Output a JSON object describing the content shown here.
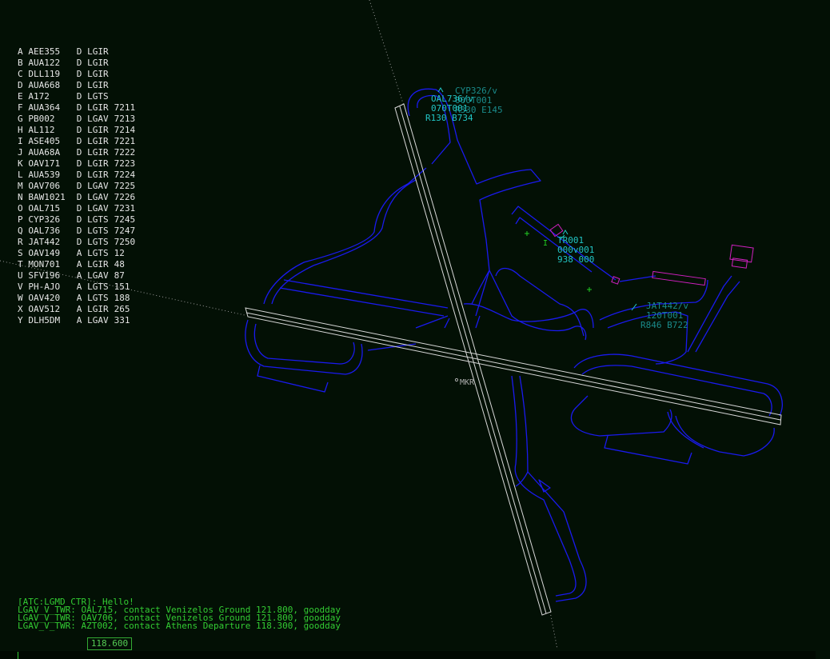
{
  "strip": [
    {
      "letter": "A",
      "callsign": "AEE355",
      "type": "D",
      "airport": "LGIR",
      "code": ""
    },
    {
      "letter": "B",
      "callsign": "AUA122",
      "type": "D",
      "airport": "LGIR",
      "code": ""
    },
    {
      "letter": "C",
      "callsign": "DLL119",
      "type": "D",
      "airport": "LGIR",
      "code": ""
    },
    {
      "letter": "D",
      "callsign": "AUA668",
      "type": "D",
      "airport": "LGIR",
      "code": ""
    },
    {
      "letter": "E",
      "callsign": "A172",
      "type": "D",
      "airport": "LGTS",
      "code": ""
    },
    {
      "letter": "F",
      "callsign": "AUA364",
      "type": "D",
      "airport": "LGIR",
      "code": "7211"
    },
    {
      "letter": "G",
      "callsign": "PB002",
      "type": "D",
      "airport": "LGAV",
      "code": "7213"
    },
    {
      "letter": "H",
      "callsign": "AL112",
      "type": "D",
      "airport": "LGIR",
      "code": "7214"
    },
    {
      "letter": "I",
      "callsign": "ASE405",
      "type": "D",
      "airport": "LGIR",
      "code": "7221"
    },
    {
      "letter": "J",
      "callsign": "AUA68A",
      "type": "D",
      "airport": "LGIR",
      "code": "7222"
    },
    {
      "letter": "K",
      "callsign": "OAV171",
      "type": "D",
      "airport": "LGIR",
      "code": "7223"
    },
    {
      "letter": "L",
      "callsign": "AUA539",
      "type": "D",
      "airport": "LGIR",
      "code": "7224"
    },
    {
      "letter": "M",
      "callsign": "OAV706",
      "type": "D",
      "airport": "LGAV",
      "code": "7225"
    },
    {
      "letter": "N",
      "callsign": "BAW1021",
      "type": "D",
      "airport": "LGAV",
      "code": "7226"
    },
    {
      "letter": "O",
      "callsign": "OAL715",
      "type": "D",
      "airport": "LGAV",
      "code": "7231"
    },
    {
      "letter": "P",
      "callsign": "CYP326",
      "type": "D",
      "airport": "LGTS",
      "code": "7245"
    },
    {
      "letter": "Q",
      "callsign": "OAL736",
      "type": "D",
      "airport": "LGTS",
      "code": "7247"
    },
    {
      "letter": "R",
      "callsign": "JAT442",
      "type": "D",
      "airport": "LGTS",
      "code": "7250"
    },
    {
      "letter": "S",
      "callsign": "OAV149",
      "type": "A",
      "airport": "LGTS",
      "code": "12"
    },
    {
      "letter": "T",
      "callsign": "MON701",
      "type": "A",
      "airport": "LGIR",
      "code": "48"
    },
    {
      "letter": "U",
      "callsign": "SFV196",
      "type": "A",
      "airport": "LGAV",
      "code": "87"
    },
    {
      "letter": "V",
      "callsign": "PH-AJO",
      "type": "A",
      "airport": "LGTS",
      "code": "151"
    },
    {
      "letter": "W",
      "callsign": "OAV420",
      "type": "A",
      "airport": "LGTS",
      "code": "188"
    },
    {
      "letter": "X",
      "callsign": "OAV512",
      "type": "A",
      "airport": "LGIR",
      "code": "265"
    },
    {
      "letter": "Y",
      "callsign": "DLH5DM",
      "type": "A",
      "airport": "LGAV",
      "code": "331"
    }
  ],
  "tags": {
    "cyp": {
      "l1": "CYP326/v",
      "l2": "000T001",
      "l3": "R330 E145"
    },
    "oal": {
      "l1": "OAL736/v",
      "l2": "070T001",
      "l3": "R130 B734"
    },
    "tr": {
      "l1": "TR001",
      "l2": "000v001",
      "l3": "938 000"
    },
    "jat": {
      "l1": "JAT442/v",
      "l2": "120T001",
      "l3": "R846 B722"
    }
  },
  "beacon": {
    "label": "MKR",
    "marker": "I"
  },
  "chat": [
    "[ATC:LGMD_CTR]: Hello!",
    "LGAV_V_TWR: OAL715, contact Venizelos Ground 121.800, goodday",
    "LGAV_V_TWR: OAV706, contact Venizelos Ground 121.800, goodday",
    "LGAV_V_TWR: AZT002, contact Athens Departure 118.300, goodday"
  ],
  "frequency": "118.600",
  "colors": {
    "background": "#031005",
    "taxiway": "#1a1aee",
    "runway": "#d8d8d8",
    "tag_cyan": "#22c4c4",
    "tag_dim": "#1a8a8a",
    "chat": "#33cc33",
    "strip_text": "#e6e6e6",
    "stand": "#d020c0",
    "fix": "#22cc22"
  }
}
